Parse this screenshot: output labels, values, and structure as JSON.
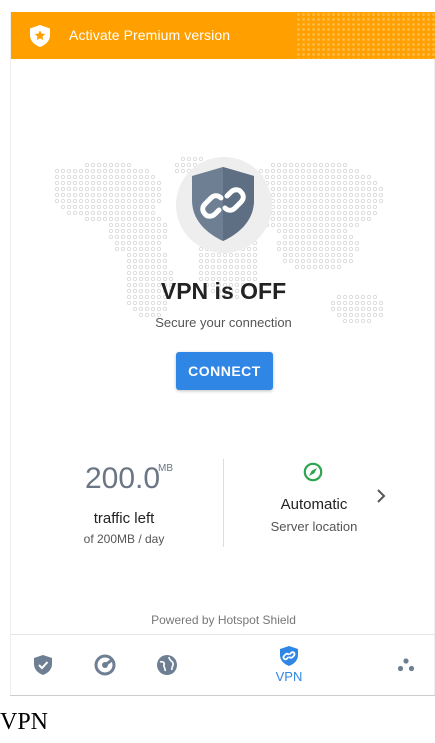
{
  "premium_banner": {
    "label": "Activate Premium version"
  },
  "status": {
    "title": "VPN is OFF",
    "subtitle": "Secure your connection",
    "connect_label": "CONNECT"
  },
  "traffic": {
    "value": "200.0",
    "unit": "MB",
    "label": "traffic left",
    "detail": "of 200MB / day"
  },
  "server": {
    "value": "Automatic",
    "label": "Server location"
  },
  "footer": {
    "powered_by": "Powered by Hotspot Shield"
  },
  "bottom_nav": {
    "items": [
      {
        "icon": "shield-check-icon"
      },
      {
        "icon": "speed-icon"
      },
      {
        "icon": "globe-icon"
      },
      {
        "icon": "vpn-shield-icon",
        "label": "VPN",
        "active": true
      },
      {
        "icon": "more-dots-icon"
      }
    ]
  },
  "caption": "VPN",
  "colors": {
    "premium": "#FFA000",
    "accent": "#2F86E4",
    "compass": "#2EA44F",
    "shield": "#6E7F93"
  }
}
